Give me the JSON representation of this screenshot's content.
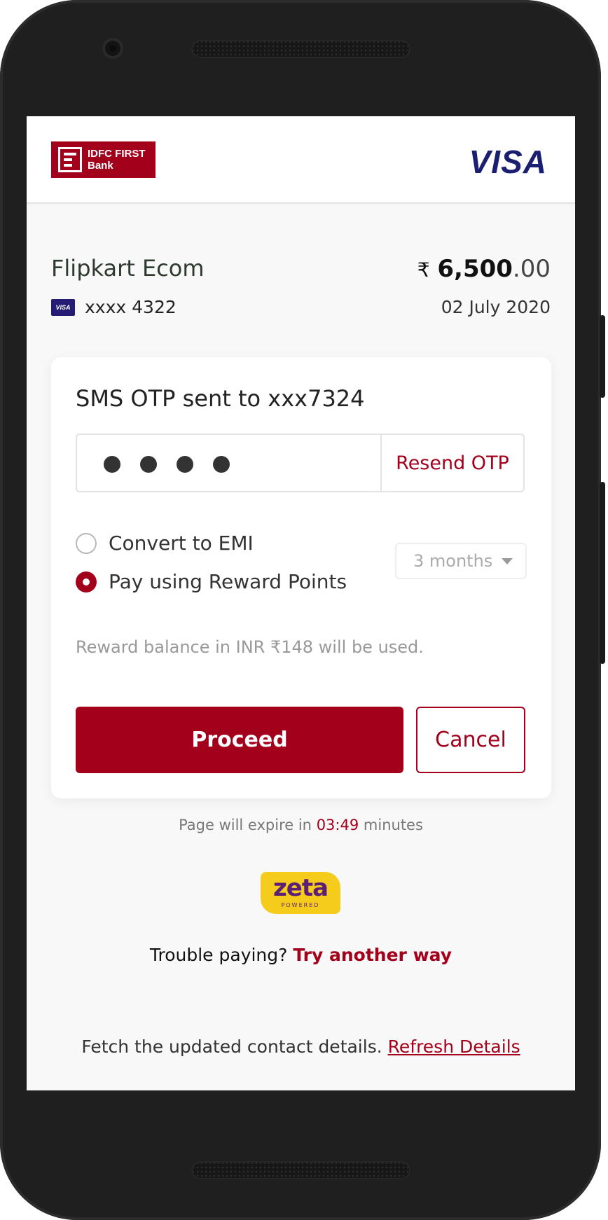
{
  "header": {
    "bank_logo_line1": "IDFC FIRST",
    "bank_logo_line2": "Bank",
    "network_logo": "VISA"
  },
  "transaction": {
    "merchant": "Flipkart Ecom",
    "currency_symbol": "₹",
    "amount_main": "6,500",
    "amount_decimal": ".00",
    "card_network_badge": "VISA",
    "card_masked": "xxxx 4322",
    "date": "02 July 2020"
  },
  "otp": {
    "title": "SMS OTP sent to xxx7324",
    "entered_digits": 4,
    "resend_label": "Resend OTP"
  },
  "options": {
    "emi_label": "Convert to EMI",
    "emi_selected": false,
    "emi_tenure": "3 months",
    "reward_label": "Pay using Reward Points",
    "reward_selected": true,
    "reward_note": "Reward balance in INR ₹148 will be used."
  },
  "actions": {
    "proceed_label": "Proceed",
    "cancel_label": "Cancel"
  },
  "expiry": {
    "prefix": "Page will expire in",
    "time": "03:49",
    "suffix": "minutes"
  },
  "branding": {
    "zeta_word": "zeta",
    "zeta_sub": "POWERED"
  },
  "help": {
    "trouble_text": "Trouble paying?",
    "trouble_link": "Try another way",
    "refresh_text": "Fetch the updated contact details.",
    "refresh_link": "Refresh Details"
  },
  "colors": {
    "brand_red": "#a3001c",
    "visa_blue": "#1a1f71",
    "zeta_yellow": "#f6cc1c",
    "zeta_purple": "#5b1f77"
  }
}
